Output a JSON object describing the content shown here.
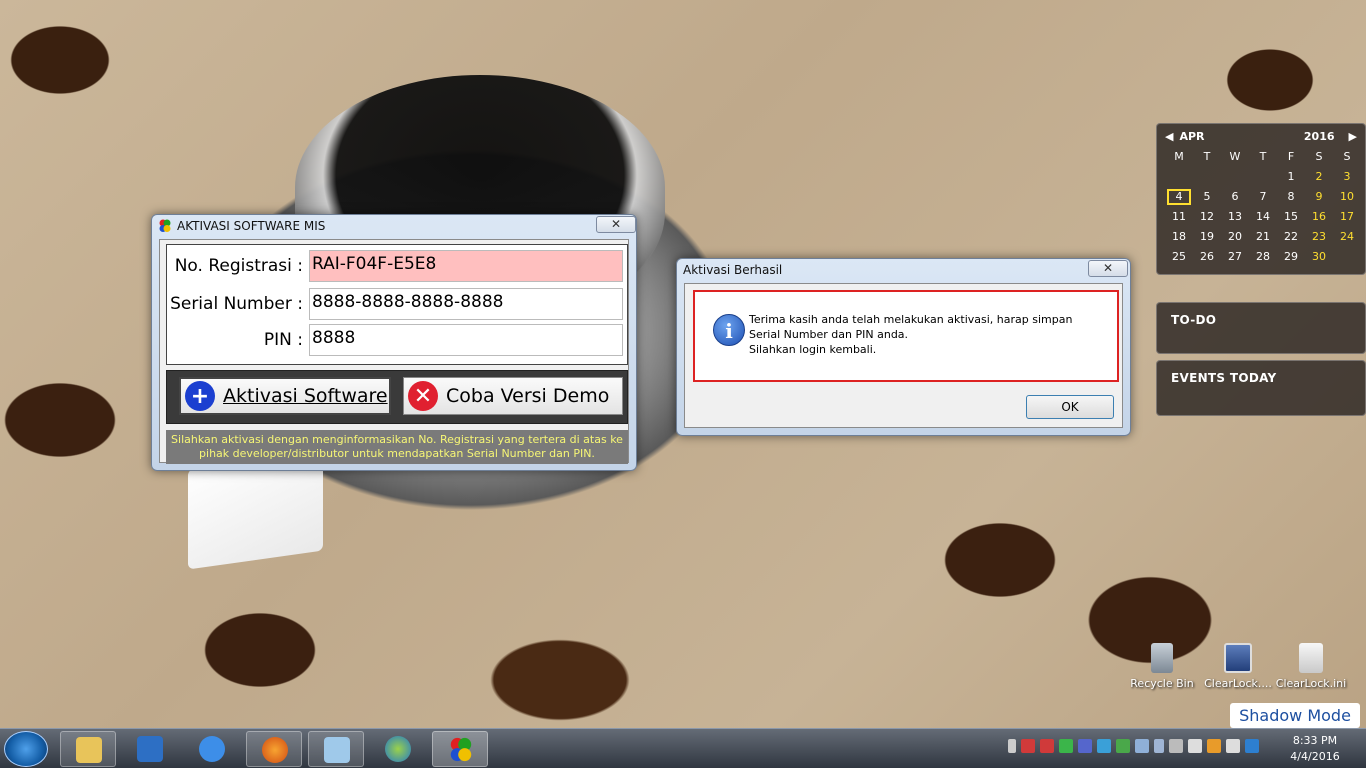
{
  "main_window": {
    "title": "AKTIVASI SOFTWARE MIS",
    "close_label": "✕",
    "fields": [
      {
        "label": "No. Registrasi :",
        "value": "RAI-F04F-E5E8"
      },
      {
        "label": "Serial Number :",
        "value": "8888-8888-8888-8888"
      },
      {
        "label": "PIN :",
        "value": "8888"
      }
    ],
    "activate_button": "Aktivasi Software",
    "demo_button": "Coba Versi Demo",
    "info_text": "Silahkan aktivasi dengan menginformasikan No. Registrasi yang tertera di atas ke pihak developer/distributor untuk mendapatkan Serial Number dan PIN."
  },
  "message_box": {
    "title": "Aktivasi Berhasil",
    "close_label": "✕",
    "line1": "Terima kasih anda telah melakukan aktivasi, harap simpan Serial Number dan PIN anda.",
    "line2": "Silahkan login kembali.",
    "ok": "OK"
  },
  "calendar": {
    "month": "APR",
    "year": "2016",
    "weekdays": [
      "M",
      "T",
      "W",
      "T",
      "F",
      "S",
      "S"
    ],
    "days": [
      "",
      "",
      "",
      "",
      "1",
      "2",
      "3",
      "4",
      "5",
      "6",
      "7",
      "8",
      "9",
      "10",
      "11",
      "12",
      "13",
      "14",
      "15",
      "16",
      "17",
      "18",
      "19",
      "20",
      "21",
      "22",
      "23",
      "24",
      "25",
      "26",
      "27",
      "28",
      "29",
      "30",
      ""
    ],
    "today": "4"
  },
  "todo_title": "TO-DO",
  "events_title": "EVENTS TODAY",
  "desktop_icons": [
    {
      "label": "Recycle Bin",
      "icon": "recycle-bin-icon"
    },
    {
      "label": "ClearLock....",
      "icon": "clearlock-app-icon"
    },
    {
      "label": "ClearLock.ini",
      "icon": "settings-file-icon"
    }
  ],
  "shadow_mode": "Shadow Mode",
  "clock": {
    "time": "8:33 PM",
    "date": "4/4/2016"
  }
}
